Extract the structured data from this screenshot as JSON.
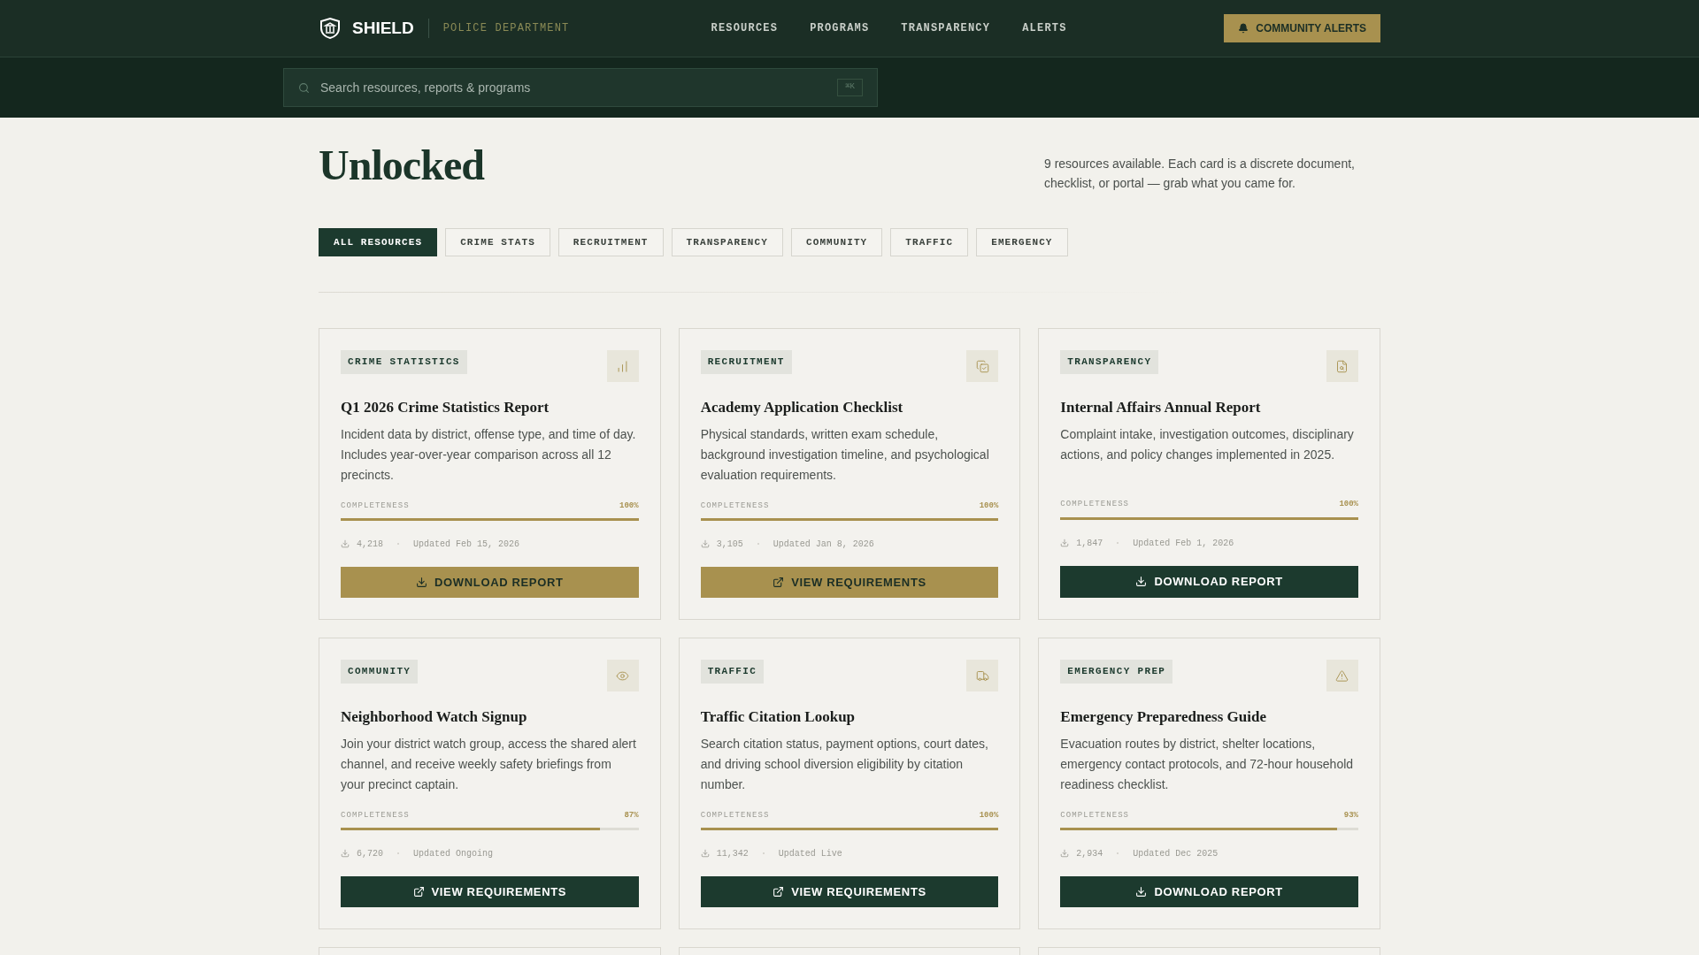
{
  "header": {
    "brand": "SHIELD",
    "subtitle": "POLICE DEPARTMENT",
    "nav": [
      {
        "label": "RESOURCES"
      },
      {
        "label": "PROGRAMS"
      },
      {
        "label": "TRANSPARENCY"
      },
      {
        "label": "ALERTS"
      }
    ],
    "cta": "COMMUNITY ALERTS"
  },
  "search": {
    "placeholder": "Search resources, reports & programs",
    "shortcut": "⌘K"
  },
  "hero": {
    "title_lines": [
      "Unlocked"
    ],
    "summary": "9 resources available. Each card is a discrete document, checklist, or portal — grab what you came for."
  },
  "filters": [
    {
      "label": "ALL RESOURCES",
      "selected": true
    },
    {
      "label": "CRIME STATS",
      "selected": false
    },
    {
      "label": "RECRUITMENT",
      "selected": false
    },
    {
      "label": "TRANSPARENCY",
      "selected": false
    },
    {
      "label": "COMMUNITY",
      "selected": false
    },
    {
      "label": "TRAFFIC",
      "selected": false
    },
    {
      "label": "EMERGENCY",
      "selected": false
    }
  ],
  "cards": [
    {
      "tag": "CRIME STATISTICS",
      "title": "Q1 2026 Crime Statistics Report",
      "description": "Incident data by district, offense type, and time of day. Includes year-over-year comparison across all 12 precincts.",
      "progress_label": "COMPLETENESS",
      "level": 1,
      "reading": "100%",
      "downloads": "4,218",
      "updated": "Updated Feb 15, 2026",
      "action": {
        "kind": "download",
        "label": "DOWNLOAD REPORT",
        "highlighted": true
      }
    },
    {
      "tag": "RECRUITMENT",
      "title": "Academy Application Checklist",
      "description": "Physical standards, written exam schedule, background investigation timeline, and psychological evaluation requirements.",
      "progress_label": "COMPLETENESS",
      "level": 1,
      "reading": "100%",
      "downloads": "3,105",
      "updated": "Updated Jan 8, 2026",
      "action": {
        "kind": "link",
        "label": "VIEW REQUIREMENTS",
        "highlighted": true
      }
    },
    {
      "tag": "TRANSPARENCY",
      "title": "Internal Affairs Annual Report",
      "description": "Complaint intake, investigation outcomes, disciplinary actions, and policy changes implemented in 2025.",
      "progress_label": "COMPLETENESS",
      "level": 1,
      "reading": "100%",
      "downloads": "1,847",
      "updated": "Updated Feb 1, 2026",
      "action": {
        "kind": "download",
        "label": "DOWNLOAD REPORT",
        "highlighted": false
      }
    },
    {
      "tag": "COMMUNITY",
      "title": "Neighborhood Watch Signup",
      "description": "Join your district watch group, access the shared alert channel, and receive weekly safety briefings from your precinct captain.",
      "progress_label": "COMPLETENESS",
      "level": 0.87,
      "reading": "87%",
      "downloads": "6,720",
      "updated": "Updated Ongoing",
      "action": {
        "kind": "link",
        "label": "VIEW REQUIREMENTS",
        "highlighted": false
      }
    },
    {
      "tag": "TRAFFIC",
      "title": "Traffic Citation Lookup",
      "description": "Search citation status, payment options, court dates, and driving school diversion eligibility by citation number.",
      "progress_label": "COMPLETENESS",
      "level": 1,
      "reading": "100%",
      "downloads": "11,342",
      "updated": "Updated Live",
      "action": {
        "kind": "link",
        "label": "VIEW REQUIREMENTS",
        "highlighted": false
      }
    },
    {
      "tag": "EMERGENCY PREP",
      "title": "Emergency Preparedness Guide",
      "description": "Evacuation routes by district, shelter locations, emergency contact protocols, and 72-hour household readiness checklist.",
      "progress_label": "COMPLETENESS",
      "level": 0.93,
      "reading": "93%",
      "downloads": "2,934",
      "updated": "Updated Dec 2025",
      "action": {
        "kind": "download",
        "label": "DOWNLOAD REPORT",
        "highlighted": false
      }
    }
  ]
}
